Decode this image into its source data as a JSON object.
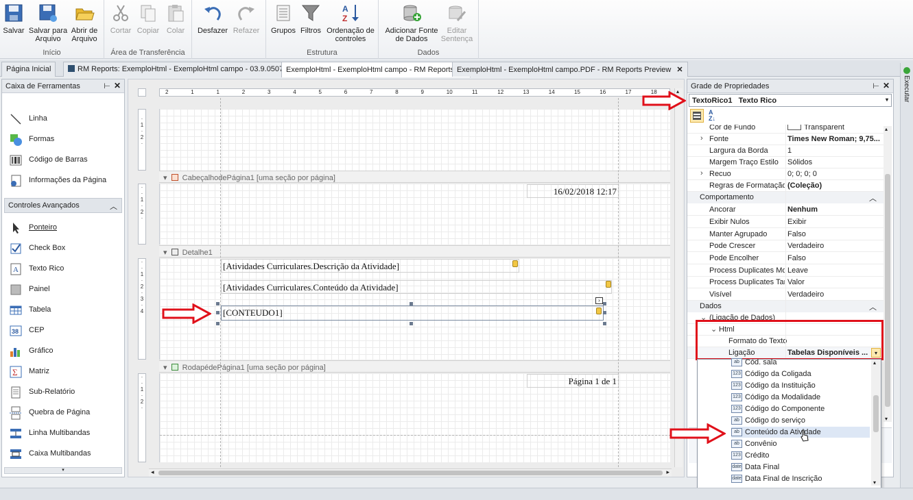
{
  "ribbon": {
    "groups": [
      {
        "label": "Início",
        "buttons": [
          {
            "label": "Salvar",
            "icon": "save-icon"
          },
          {
            "label": "Salvar para Arquivo",
            "icon": "save-file-icon"
          },
          {
            "label": "Abrir de Arquivo",
            "icon": "folder-open-icon"
          }
        ]
      },
      {
        "label": "Área de Transferência",
        "buttons": [
          {
            "label": "Cortar",
            "icon": "cut-icon"
          },
          {
            "label": "Copiar",
            "icon": "copy-icon"
          },
          {
            "label": "Colar",
            "icon": "paste-icon"
          }
        ]
      },
      {
        "label": "",
        "buttons": [
          {
            "label": "Desfazer",
            "icon": "undo-icon"
          },
          {
            "label": "Refazer",
            "icon": "redo-icon"
          }
        ]
      },
      {
        "label": "Estrutura",
        "buttons": [
          {
            "label": "Grupos",
            "icon": "groups-icon"
          },
          {
            "label": "Filtros",
            "icon": "filter-icon"
          },
          {
            "label": "Ordenação de controles",
            "icon": "sort-az-icon"
          }
        ]
      },
      {
        "label": "Dados",
        "buttons": [
          {
            "label": "Adicionar Fonte de Dados",
            "icon": "add-datasource-icon"
          },
          {
            "label": "Editar Sentença",
            "icon": "edit-sentence-icon"
          }
        ]
      }
    ]
  },
  "tabs": [
    {
      "label": "Página Inicial"
    },
    {
      "label": "RM Reports: ExemploHtml - ExemploHtml campo - 03.9.0507"
    },
    {
      "label": "ExemploHtml - ExemploHtml campo - RM Reports"
    },
    {
      "label": "ExemploHtml - ExemploHtml campo.PDF - RM Reports Preview"
    }
  ],
  "toolbox": {
    "title": "Caixa de Ferramentas",
    "items_top": [
      {
        "label": "Linha",
        "icon": "line-icon"
      },
      {
        "label": "Formas",
        "icon": "shapes-icon"
      },
      {
        "label": "Código de Barras",
        "icon": "barcode-icon"
      },
      {
        "label": "Informações da Página",
        "icon": "page-info-icon"
      }
    ],
    "section": "Controles Avançados",
    "items": [
      {
        "label": "Ponteiro",
        "icon": "pointer-icon"
      },
      {
        "label": "Check Box",
        "icon": "checkbox-icon"
      },
      {
        "label": "Texto Rico",
        "icon": "rich-text-icon"
      },
      {
        "label": "Painel",
        "icon": "panel-icon"
      },
      {
        "label": "Tabela",
        "icon": "table-icon"
      },
      {
        "label": "CEP",
        "icon": "zipcode-icon"
      },
      {
        "label": "Gráfico",
        "icon": "chart-icon"
      },
      {
        "label": "Matriz",
        "icon": "matrix-icon"
      },
      {
        "label": "Sub-Relatório",
        "icon": "subreport-icon"
      },
      {
        "label": "Quebra de Página",
        "icon": "page-break-icon"
      },
      {
        "label": "Linha Multibandas",
        "icon": "multiband-line-icon"
      },
      {
        "label": "Caixa Multibandas",
        "icon": "multiband-box-icon"
      }
    ]
  },
  "designer": {
    "ruler_ticks": [
      "2",
      "1",
      "1",
      "2",
      "3",
      "4",
      "5",
      "6",
      "7",
      "8",
      "9",
      "10",
      "11",
      "12",
      "13",
      "14",
      "15",
      "16",
      "17",
      "18"
    ],
    "bands": {
      "header": "CabeçalhodePágina1 [uma seção por página]",
      "detail": "Detalhe1",
      "footer": "RodapédePágina1 [uma seção por página]"
    },
    "header_date": "16/02/2018 12:17",
    "detail_fields": [
      "[Atividades Curriculares.Descrição da Atividade]",
      "[Atividades Curriculares.Conteúdo da Atividade]",
      "[CONTEUDO1]"
    ],
    "footer_page": "Página 1 de 1"
  },
  "properties": {
    "title": "Grade de Propriedades",
    "object_name": "TextoRico1",
    "object_type": "Texto Rico",
    "rows_appearance": [
      {
        "name": "Cor de Fundo",
        "value": "Transparent"
      },
      {
        "name": "Fonte",
        "value": "Times New Roman; 9,75..."
      },
      {
        "name": "Largura da Borda",
        "value": "1"
      },
      {
        "name": "Margem Traço Estilo",
        "value": "Sólidos"
      },
      {
        "name": "Recuo",
        "value": "0; 0; 0; 0"
      },
      {
        "name": "Regras de Formatação",
        "value": "(Coleção)"
      }
    ],
    "cat_behavior": "Comportamento",
    "rows_behavior": [
      {
        "name": "Ancorar",
        "value": "Nenhum"
      },
      {
        "name": "Exibir Nulos",
        "value": "Exibir"
      },
      {
        "name": "Manter Agrupado",
        "value": "Falso"
      },
      {
        "name": "Pode Crescer",
        "value": "Verdadeiro"
      },
      {
        "name": "Pode Encolher",
        "value": "Falso"
      },
      {
        "name": "Process Duplicates Mode",
        "value": "Leave"
      },
      {
        "name": "Process Duplicates Target",
        "value": "Valor"
      },
      {
        "name": "Visível",
        "value": "Verdadeiro"
      }
    ],
    "cat_data": "Dados",
    "data_binding": "(Ligação de Dados)",
    "html": "Html",
    "text_format": "Formato do Texto",
    "binding_label": "Ligação",
    "binding_value": "Tabelas Disponíveis ..."
  },
  "dropdown_items": [
    {
      "label": "Cód. sala",
      "icon": "ab"
    },
    {
      "label": "Código da Coligada",
      "icon": "123"
    },
    {
      "label": "Código da Instituição",
      "icon": "123"
    },
    {
      "label": "Código da Modalidade",
      "icon": "123"
    },
    {
      "label": "Código do Componente",
      "icon": "123"
    },
    {
      "label": "Código do serviço",
      "icon": "ab"
    },
    {
      "label": "Conteúdo da Atividade",
      "icon": "ab"
    },
    {
      "label": "Convênio",
      "icon": "ab"
    },
    {
      "label": "Crédito",
      "icon": "123"
    },
    {
      "label": "Data Final",
      "icon": "date"
    },
    {
      "label": "Data Final de Inscrição",
      "icon": "date"
    }
  ],
  "right_edge": "Executar",
  "colors": {
    "highlight_red": "#e0101a",
    "selection": "#dde7f5"
  }
}
